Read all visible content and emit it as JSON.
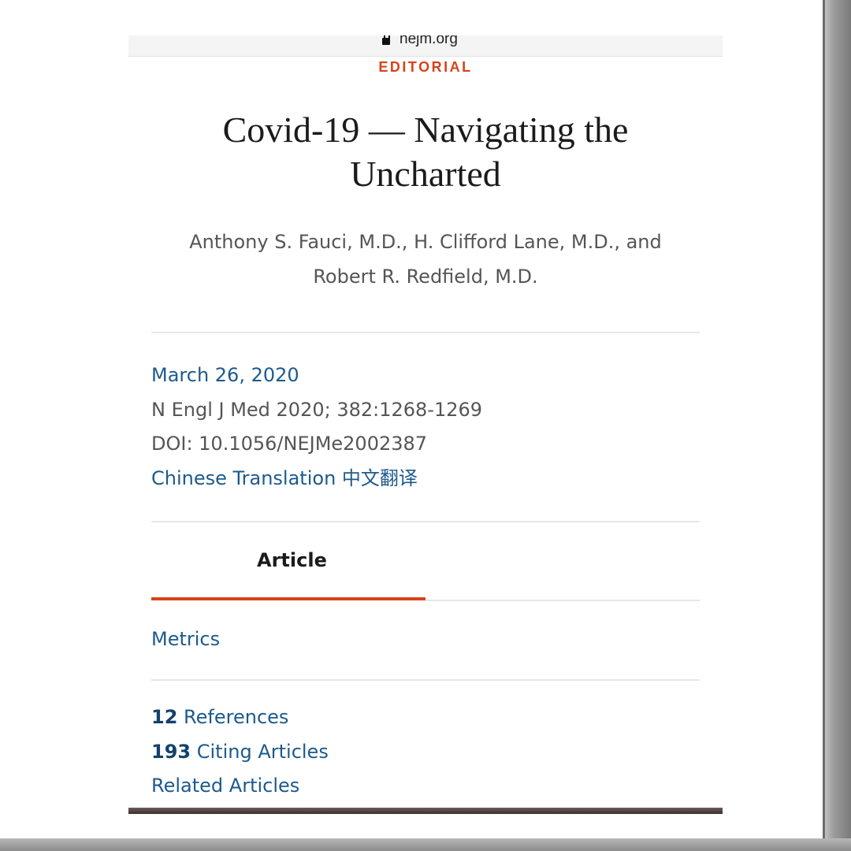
{
  "browser": {
    "url": "nejm.org"
  },
  "article": {
    "section_label": "EDITORIAL",
    "title": "Covid-19 — Navigating the Uncharted",
    "authors_line1": "Anthony S. Fauci, M.D., H. Clifford Lane, M.D., and",
    "authors_line2": "Robert R. Redfield, M.D.",
    "date": "March 26, 2020",
    "citation": "N Engl J Med 2020; 382:1268-1269",
    "doi": "DOI: 10.1056/NEJMe2002387",
    "translation_link": "Chinese Translation 中文翻译"
  },
  "tabs": {
    "active_label": "Article"
  },
  "metrics_link": "Metrics",
  "related": {
    "references_count": "12",
    "references_label": "References",
    "citing_count": "193",
    "citing_label": "Citing Articles",
    "related_label": "Related Articles"
  },
  "colors": {
    "accent": "#d8421a",
    "link": "#1d5a8c",
    "text": "#1b1b1b",
    "muted": "#555555"
  }
}
